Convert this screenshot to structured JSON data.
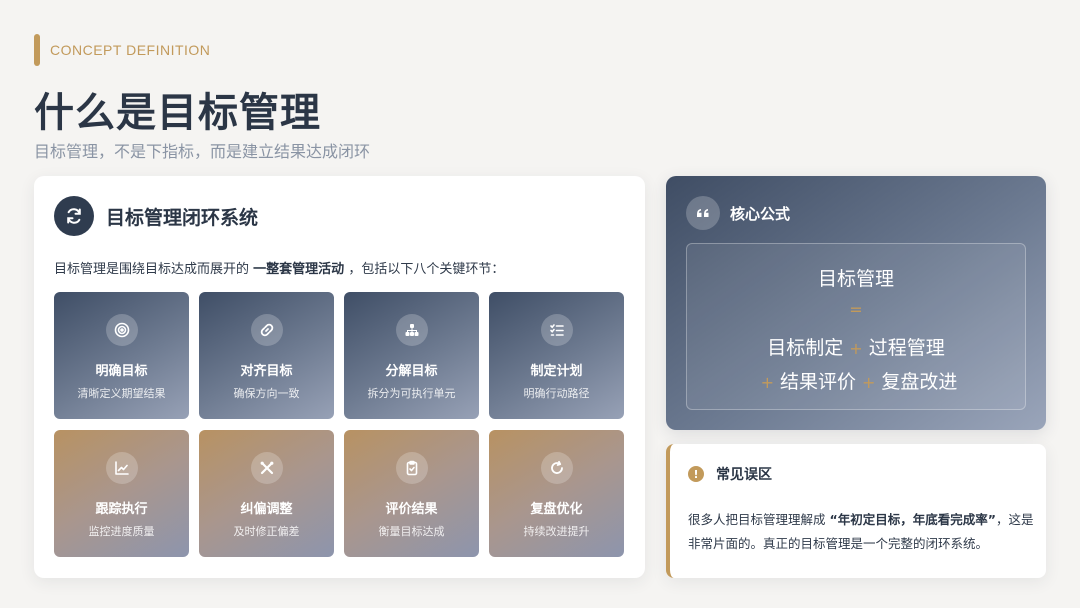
{
  "header": {
    "eyebrow": "CONCEPT DEFINITION",
    "title": "什么是目标管理",
    "subtitle": "目标管理，不是下指标，而是建立结果达成闭环"
  },
  "system_card": {
    "icon": "refresh-icon",
    "title": "目标管理闭环系统",
    "intro_before": "目标管理是围绕目标达成而展开的",
    "intro_bold": "一整套管理活动",
    "intro_after": "，包括以下八个关键环节：",
    "steps": [
      {
        "icon": "target-icon",
        "title": "明确目标",
        "desc": "清晰定义期望结果"
      },
      {
        "icon": "link-icon",
        "title": "对齐目标",
        "desc": "确保方向一致"
      },
      {
        "icon": "hierarchy-icon",
        "title": "分解目标",
        "desc": "拆分为可执行单元"
      },
      {
        "icon": "checklist-icon",
        "title": "制定计划",
        "desc": "明确行动路径"
      },
      {
        "icon": "trend-chart-icon",
        "title": "跟踪执行",
        "desc": "监控进度质量"
      },
      {
        "icon": "tools-icon",
        "title": "纠偏调整",
        "desc": "及时修正偏差"
      },
      {
        "icon": "clipboard-check-icon",
        "title": "评价结果",
        "desc": "衡量目标达成"
      },
      {
        "icon": "redo-icon",
        "title": "复盘优化",
        "desc": "持续改进提升"
      }
    ]
  },
  "formula_card": {
    "icon": "quote-icon",
    "title": "核心公式",
    "result": "目标管理",
    "equals": "=",
    "plus": "+",
    "terms": [
      "目标制定",
      "过程管理",
      "结果评价",
      "复盘改进"
    ]
  },
  "pitfall_card": {
    "icon": "exclamation-icon",
    "title": "常见误区",
    "text_before": "很多人把目标管理理解成",
    "text_bold": "“年初定目标，年底看完成率”",
    "text_after": "，这是非常片面的。真正的目标管理是一个完整的闭环系统。"
  },
  "colors": {
    "background": "#f5f4f2",
    "accent": "#c29a5b",
    "navy": "#2f3c4f",
    "text": "#2b3646",
    "muted": "#8a94a4"
  }
}
